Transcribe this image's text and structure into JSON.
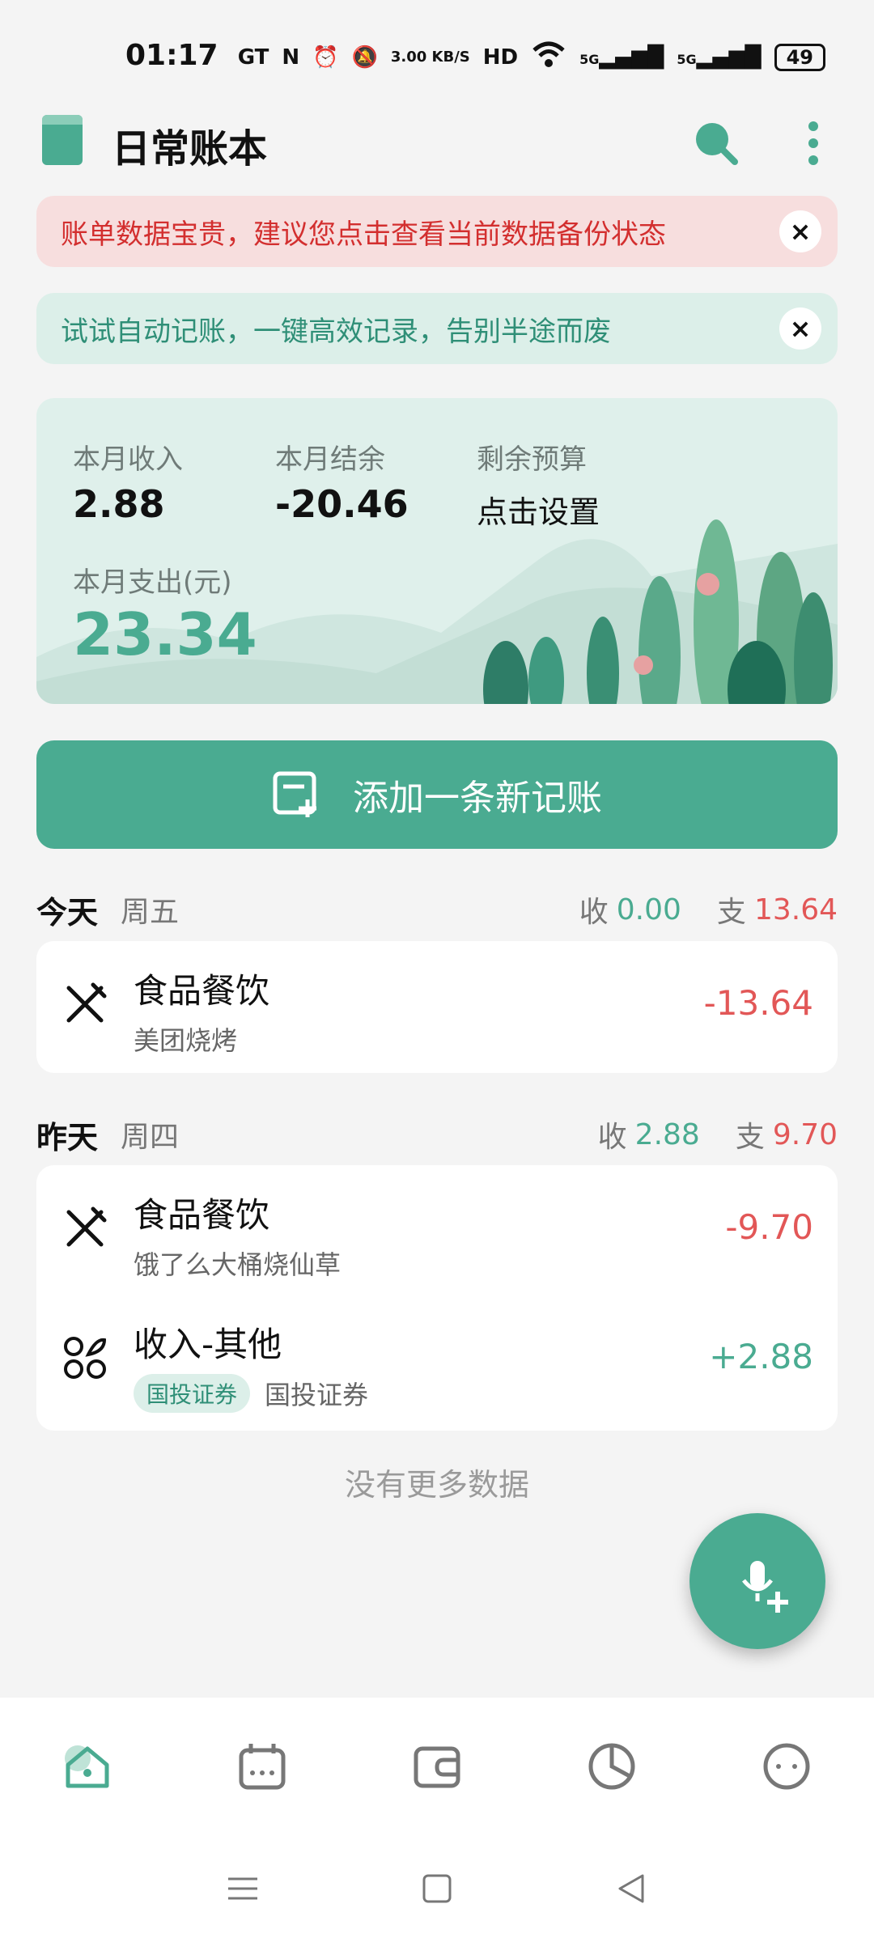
{
  "status_bar": {
    "time": "01:17",
    "net_speed": "3.00 KB/S",
    "battery": "49",
    "signal1": "5G",
    "signal2": "5G"
  },
  "header": {
    "title": "日常账本"
  },
  "banners": {
    "backup": "账单数据宝贵，建议您点击查看当前数据备份状态",
    "auto": "试试自动记账，一键高效记录，告别半途而废",
    "close_glyph": "×"
  },
  "summary": {
    "income_label": "本月收入",
    "income_value": "2.88",
    "balance_label": "本月结余",
    "balance_value": "-20.46",
    "budget_label": "剩余预算",
    "budget_value": "点击设置",
    "expense_label": "本月支出(元)",
    "expense_value": "23.34"
  },
  "add_button": {
    "label": "添加一条新记账"
  },
  "days": [
    {
      "day": "今天",
      "weekday": "周五",
      "income_label": "收",
      "income": "0.00",
      "expense_label": "支",
      "expense": "13.64",
      "records": [
        {
          "title": "食品餐饮",
          "note": "美团烧烤",
          "amount": "-13.64",
          "icon": "fork-knife-icon"
        }
      ]
    },
    {
      "day": "昨天",
      "weekday": "周四",
      "income_label": "收",
      "income": "2.88",
      "expense_label": "支",
      "expense": "9.70",
      "records": [
        {
          "title": "食品餐饮",
          "note": "饿了么大桶烧仙草",
          "amount": "-9.70",
          "icon": "fork-knife-icon"
        },
        {
          "title": "收入-其他",
          "tag": "国投证券",
          "note": "国投证券",
          "amount": "+2.88",
          "icon": "category-grid-icon"
        }
      ]
    }
  ],
  "no_more": "没有更多数据",
  "nav": [
    "home-icon",
    "calendar-icon",
    "wallet-icon",
    "chart-icon",
    "profile-icon"
  ],
  "colors": {
    "accent": "#4aab91",
    "expense": "#e25757",
    "warning": "#d32f2f"
  }
}
